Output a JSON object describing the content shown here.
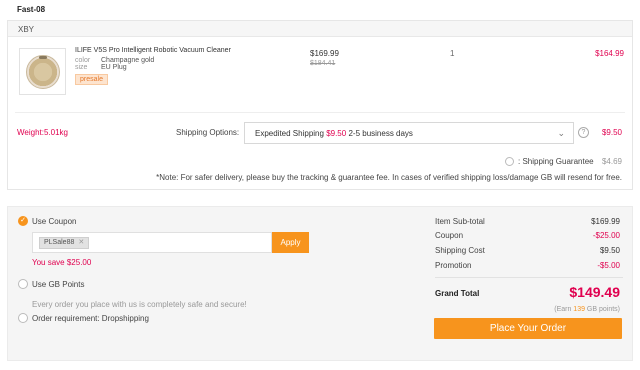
{
  "page": {
    "title": "Fast-08"
  },
  "store": {
    "name": "XBY"
  },
  "product": {
    "name": "ILIFE V5S Pro Intelligent Robotic Vacuum Cleaner",
    "color_label": "color",
    "color_value": "Champagne gold",
    "size_label": "size",
    "size_value": "EU Plug",
    "tag": "presale",
    "price": "$169.99",
    "old_price": "$184.41",
    "quantity": "1",
    "line_total": "$164.99"
  },
  "shipping": {
    "weight": "Weight:5.01kg",
    "options_label": "Shipping Options:",
    "method": "Expedited Shipping",
    "method_fee": "$9.50",
    "method_time": "2-5 business days",
    "fee": "$9.50",
    "guarantee_label": ": Shipping Guarantee",
    "guarantee_fee": "$4.69",
    "note": "*Note: For safer delivery, please buy the tracking & guarantee fee. In cases of verified shipping loss/damage GB will resend for free."
  },
  "coupon": {
    "use_label": "Use Coupon",
    "code": "PLSale88",
    "apply_label": "Apply",
    "saved_text": "You save $25.00"
  },
  "points": {
    "use_label": "Use GB Points",
    "note": "Every order you place with us is completely safe and secure!"
  },
  "dropship": {
    "label": "Order requirement: Dropshipping"
  },
  "summary": {
    "subtotal_label": "Item Sub-total",
    "subtotal": "$169.99",
    "coupon_label": "Coupon",
    "coupon": "-$25.00",
    "shipping_label": "Shipping Cost",
    "shipping": "$9.50",
    "promotion_label": "Promotion",
    "promotion": "-$5.00",
    "grand_label": "Grand Total",
    "grand": "$149.49",
    "earn_prefix": "(Earn ",
    "earn_points": "139",
    "earn_suffix": " GB points)",
    "place_order_label": "Place Your Order"
  },
  "colors": {
    "accent": "#f7941d",
    "price_red": "#e0004f"
  },
  "icons": [
    "check-icon",
    "chevron-down-icon",
    "help-icon",
    "close-icon",
    "radio-icon"
  ]
}
